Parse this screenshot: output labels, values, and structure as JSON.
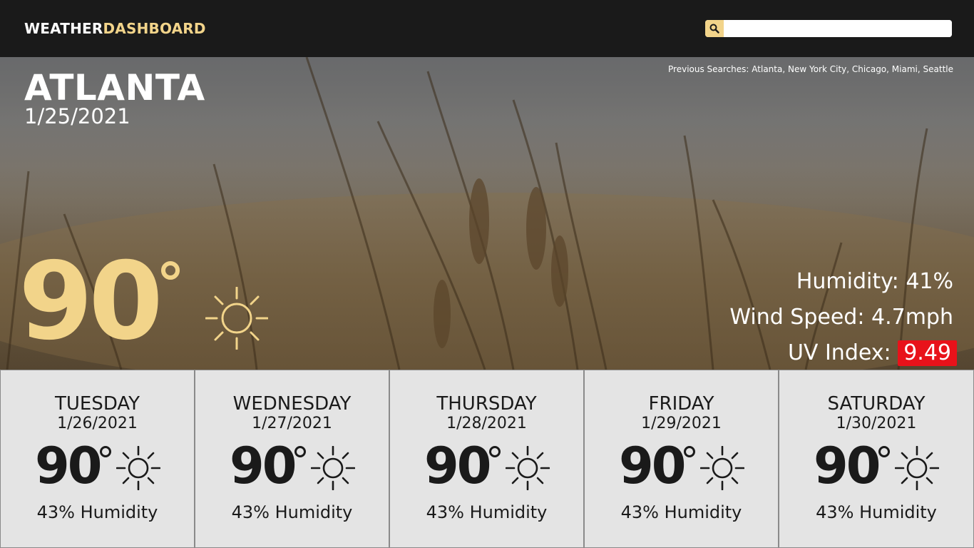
{
  "header": {
    "brand_part1": "WEATHER",
    "brand_part2": "DASHBOARD",
    "search_icon": "search-icon",
    "search_value": "",
    "search_placeholder": ""
  },
  "current": {
    "city": "ATLANTA",
    "date": "1/25/2021",
    "temperature": "90",
    "condition_icon": "sun-icon",
    "humidity_label": "Humidity:",
    "humidity_value": "41%",
    "wind_label": "Wind Speed:",
    "wind_value": "4.7mph",
    "uv_label": "UV Index:",
    "uv_value": "9.49"
  },
  "previous_searches": {
    "label": "Previous Searches:",
    "items": [
      "Atlanta",
      "New York City",
      "Chicago",
      "Miami",
      "Seattle"
    ]
  },
  "forecast": [
    {
      "day": "TUESDAY",
      "date": "1/26/2021",
      "temp": "90",
      "icon": "sun-icon",
      "humidity": "43% Humidity"
    },
    {
      "day": "WEDNESDAY",
      "date": "1/27/2021",
      "temp": "90",
      "icon": "sun-icon",
      "humidity": "43% Humidity"
    },
    {
      "day": "THURSDAY",
      "date": "1/28/2021",
      "temp": "90",
      "icon": "sun-icon",
      "humidity": "43% Humidity"
    },
    {
      "day": "FRIDAY",
      "date": "1/29/2021",
      "temp": "90",
      "icon": "sun-icon",
      "humidity": "43% Humidity"
    },
    {
      "day": "SATURDAY",
      "date": "1/30/2021",
      "temp": "90",
      "icon": "sun-icon",
      "humidity": "43% Humidity"
    }
  ],
  "colors": {
    "accent": "#f2d48a",
    "header_bg": "#1a1a1a",
    "uv_badge": "#e8121a",
    "card_bg": "#e4e4e4"
  }
}
